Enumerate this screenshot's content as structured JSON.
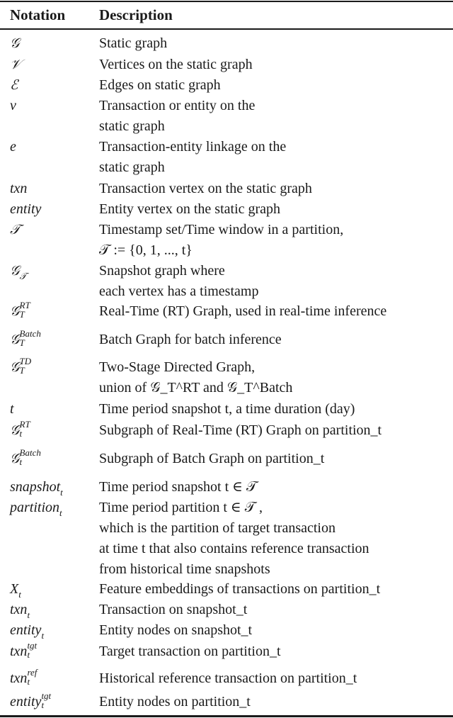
{
  "table": {
    "headers": {
      "notation": "Notation",
      "description": "Description"
    },
    "rows": [
      {
        "symbol": "𝒢",
        "lines": [
          "Static graph"
        ]
      },
      {
        "symbol": "𝒱",
        "lines": [
          "Vertices on the static graph"
        ]
      },
      {
        "symbol": "ℰ",
        "lines": [
          "Edges on static graph"
        ]
      },
      {
        "symbol": "v",
        "lines": [
          "Transaction or entity on the",
          "static graph"
        ]
      },
      {
        "symbol": "e",
        "lines": [
          "Transaction-entity linkage on the",
          "static graph"
        ]
      },
      {
        "symbol": "txn",
        "lines": [
          "Transaction vertex on the static graph"
        ]
      },
      {
        "symbol": "entity",
        "lines": [
          "Entity vertex on the static graph"
        ]
      },
      {
        "symbol": "𝒯",
        "lines": [
          "Timestamp set/Time window in a partition,",
          "𝒯 := {0, 1, ..., t}"
        ]
      },
      {
        "symbol": "𝒢",
        "sub": "𝒯",
        "lines": [
          "Snapshot graph where",
          "each vertex has a timestamp"
        ]
      },
      {
        "symbol": "𝒢",
        "sup": "RT",
        "sub": "T",
        "lines": [
          "Real-Time (RT) Graph, used in real-time inference"
        ]
      },
      {
        "symbol": "𝒢",
        "sup": "Batch",
        "sub": "T",
        "lines": [
          "Batch Graph for batch inference"
        ]
      },
      {
        "symbol": "𝒢",
        "sup": "TD",
        "sub": "T",
        "lines": [
          "Two-Stage Directed Graph,",
          "union of 𝒢_T^RT and 𝒢_T^Batch"
        ]
      },
      {
        "symbol": "t",
        "lines": [
          "Time period snapshot t, a time duration (day)"
        ]
      },
      {
        "symbol": "𝒢",
        "sup": "RT",
        "sub": "t",
        "lines": [
          "Subgraph of Real-Time (RT) Graph on partition_t"
        ]
      },
      {
        "symbol": "𝒢",
        "sup": "Batch",
        "sub": "t",
        "lines": [
          "Subgraph of Batch Graph on partition_t"
        ]
      },
      {
        "symbol": "snapshot",
        "sub": "t",
        "lines": [
          "Time period snapshot t ∈ 𝒯"
        ]
      },
      {
        "symbol": "partition",
        "sub": "t",
        "lines": [
          "Time period partition t ∈ 𝒯 ,",
          "which is the partition of target transaction",
          "at time t that also contains reference transaction",
          "from historical time snapshots"
        ]
      },
      {
        "symbol": "X",
        "sub": "t",
        "lines": [
          "Feature embeddings of transactions on partition_t"
        ]
      },
      {
        "symbol": "txn",
        "sub": "t",
        "lines": [
          "Transaction on snapshot_t"
        ]
      },
      {
        "symbol": "entity",
        "sub": "t",
        "lines": [
          "Entity nodes on snapshot_t"
        ]
      },
      {
        "symbol": "txn",
        "sup": "tgt",
        "sub": "t",
        "lines": [
          "Target transaction on partition_t"
        ]
      },
      {
        "symbol": "txn",
        "sup": "ref",
        "sub": "t",
        "lines": [
          "Historical reference transaction on partition_t"
        ]
      },
      {
        "symbol": "entity",
        "sup": "tgt",
        "sub": "t",
        "lines": [
          "Entity nodes on partition_t"
        ]
      }
    ]
  }
}
